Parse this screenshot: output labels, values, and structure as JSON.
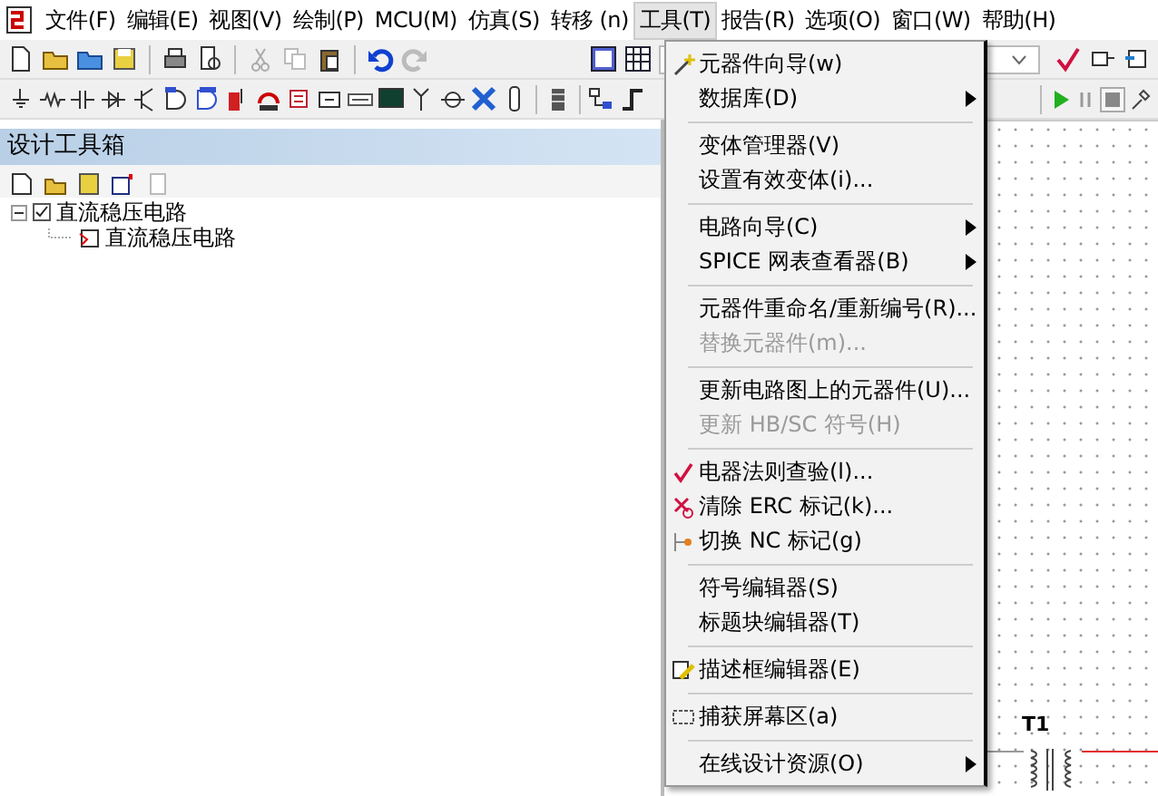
{
  "menu_bar": [
    {
      "label": "文件(F)",
      "selected": false
    },
    {
      "label": "编辑(E)",
      "selected": false
    },
    {
      "label": "视图(V)",
      "selected": false
    },
    {
      "label": "绘制(P)",
      "selected": false
    },
    {
      "label": "MCU(M)",
      "selected": false
    },
    {
      "label": "仿真(S)",
      "selected": false
    },
    {
      "label": "转移 (n)",
      "selected": false
    },
    {
      "label": "工具(T)",
      "selected": true
    },
    {
      "label": "报告(R)",
      "selected": false
    },
    {
      "label": "选项(O)",
      "selected": false
    },
    {
      "label": "窗口(W)",
      "selected": false
    },
    {
      "label": "帮助(H)",
      "selected": false
    }
  ],
  "design_toolbox": {
    "title": "设计工具箱",
    "tree": [
      {
        "label": "直流稳压电路",
        "checked": true,
        "expanded": true,
        "children": [
          {
            "label": "直流稳压电路"
          }
        ]
      }
    ]
  },
  "tools_menu": {
    "items": [
      {
        "kind": "item",
        "label": "元器件向导(w)",
        "disabled": false,
        "submenu": false
      },
      {
        "kind": "item",
        "label": "数据库(D)",
        "disabled": false,
        "submenu": true
      },
      {
        "kind": "separator"
      },
      {
        "kind": "item",
        "label": "变体管理器(V)",
        "disabled": false,
        "submenu": false
      },
      {
        "kind": "item",
        "label": "设置有效变体(i)...",
        "disabled": false,
        "submenu": false
      },
      {
        "kind": "separator"
      },
      {
        "kind": "item",
        "label": "电路向导(C)",
        "disabled": false,
        "submenu": true
      },
      {
        "kind": "item",
        "label": "SPICE 网表查看器(B)",
        "disabled": false,
        "submenu": true
      },
      {
        "kind": "separator"
      },
      {
        "kind": "item",
        "label": "元器件重命名/重新编号(R)...",
        "disabled": false,
        "submenu": false
      },
      {
        "kind": "item",
        "label": "替换元器件(m)...",
        "disabled": true,
        "submenu": false
      },
      {
        "kind": "separator"
      },
      {
        "kind": "item",
        "label": "更新电路图上的元器件(U)...",
        "disabled": false,
        "submenu": false
      },
      {
        "kind": "item",
        "label": "更新 HB/SC 符号(H)",
        "disabled": true,
        "submenu": false
      },
      {
        "kind": "separator"
      },
      {
        "kind": "item",
        "label": "电器法则查验(l)...",
        "disabled": false,
        "submenu": false
      },
      {
        "kind": "item",
        "label": "清除 ERC 标记(k)...",
        "disabled": false,
        "submenu": false
      },
      {
        "kind": "item",
        "label": "切换 NC 标记(g)",
        "disabled": false,
        "submenu": false
      },
      {
        "kind": "separator"
      },
      {
        "kind": "item",
        "label": "符号编辑器(S)",
        "disabled": false,
        "submenu": false
      },
      {
        "kind": "item",
        "label": "标题块编辑器(T)",
        "disabled": false,
        "submenu": false
      },
      {
        "kind": "separator"
      },
      {
        "kind": "item",
        "label": "描述框编辑器(E)",
        "disabled": false,
        "submenu": false
      },
      {
        "kind": "separator"
      },
      {
        "kind": "item",
        "label": "捕获屏幕区(a)",
        "disabled": false,
        "submenu": false
      },
      {
        "kind": "separator"
      },
      {
        "kind": "item",
        "label": "在线设计资源(O)",
        "disabled": false,
        "submenu": true
      }
    ]
  },
  "canvas": {
    "labels": [
      {
        "text": "T1"
      }
    ]
  }
}
